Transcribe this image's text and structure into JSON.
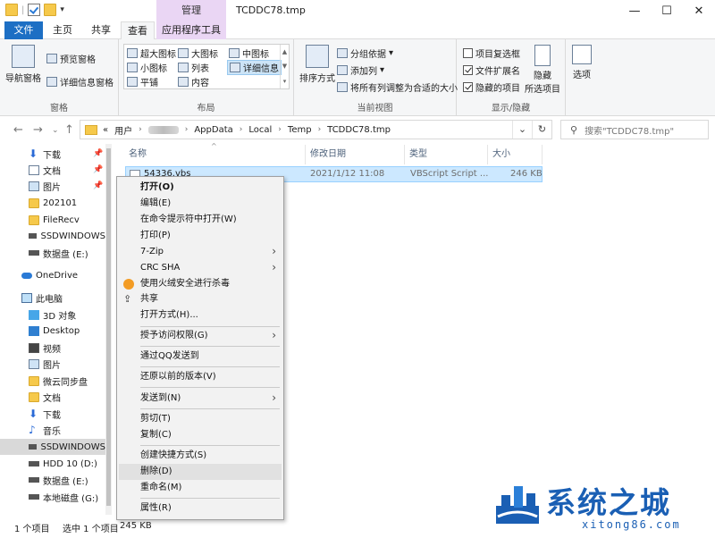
{
  "window": {
    "title": "TCDDC78.tmp",
    "context_tab_header": "管理",
    "controls": [
      "—",
      "☐",
      "✕"
    ]
  },
  "ribbon_tabs": {
    "file": "文件",
    "home": "主页",
    "share": "共享",
    "view": "查看",
    "app_tools": "应用程序工具"
  },
  "ribbon": {
    "pane": {
      "nav_pane": "导航窗格",
      "preview_pane": "预览窗格",
      "details_pane": "详细信息窗格",
      "label": "窗格"
    },
    "layout": {
      "xl_icons": "超大图标",
      "large_icons": "大图标",
      "medium_icons": "中图标",
      "small_icons": "小图标",
      "list": "列表",
      "details": "详细信息",
      "tiles": "平铺",
      "content": "内容",
      "label": "布局"
    },
    "current_view": {
      "sort_by": "排序方式",
      "group_by": "分组依据",
      "add_columns": "添加列",
      "size_all_columns": "将所有列调整为合适的大小",
      "label": "当前视图"
    },
    "show_hide": {
      "item_checkboxes": "项目复选框",
      "file_extensions": "文件扩展名",
      "hidden_items": "隐藏的项目",
      "hide_selected_1": "隐藏",
      "hide_selected_2": "所选项目",
      "label": "显示/隐藏",
      "item_checkboxes_checked": false,
      "file_extensions_checked": true,
      "hidden_items_checked": true
    },
    "options": "选项"
  },
  "address": {
    "prefix": "«",
    "crumbs": [
      "用户",
      "AppData",
      "Local",
      "Temp",
      "TCDDC78.tmp"
    ],
    "search_placeholder": "搜索\"TCDDC78.tmp\""
  },
  "sidebar": {
    "quick": [
      {
        "label": "下载",
        "pinned": true
      },
      {
        "label": "文档",
        "pinned": true
      },
      {
        "label": "图片",
        "pinned": true
      },
      {
        "label": "202101"
      },
      {
        "label": "FileRecv"
      },
      {
        "label": "SSDWINDOWS"
      },
      {
        "label": "数据盘 (E:)"
      }
    ],
    "onedrive": "OneDrive",
    "this_pc": "此电脑",
    "pc_items": [
      "3D 对象",
      "Desktop",
      "视频",
      "图片",
      "微云同步盘",
      "文档",
      "下载",
      "音乐",
      "SSDWINDOWS",
      "HDD 10 (D:)",
      "数据盘 (E:)",
      "本地磁盘 (G:)"
    ]
  },
  "file_list": {
    "columns": {
      "name": "名称",
      "date": "修改日期",
      "type": "类型",
      "size": "大小"
    },
    "rows": [
      {
        "name": "54336.vbs",
        "date": "2021/1/12 11:08",
        "type": "VBScript Script ...",
        "size": "246 KB"
      }
    ]
  },
  "context_menu": {
    "open": "打开(O)",
    "edit": "编辑(E)",
    "open_cmd": "在命令提示符中打开(W)",
    "print": "打印(P)",
    "zip": "7-Zip",
    "crc": "CRC SHA",
    "antivirus": "使用火绒安全进行杀毒",
    "share": "共享",
    "open_with": "打开方式(H)...",
    "grant_access": "授予访问权限(G)",
    "qq_send": "通过QQ发送到",
    "restore": "还原以前的版本(V)",
    "send_to": "发送到(N)",
    "cut": "剪切(T)",
    "copy": "复制(C)",
    "create_shortcut": "创建快捷方式(S)",
    "delete": "删除(D)",
    "rename": "重命名(M)",
    "properties": "属性(R)"
  },
  "status": {
    "count": "1 个项目",
    "selected": "选中 1 个项目",
    "size": "245 KB"
  },
  "watermark": {
    "name": "系统之城",
    "url": "xitong86.com"
  },
  "colors": {
    "accent": "#1d6fc4",
    "context_tab": "#ead6f4",
    "selection": "#cce8ff"
  }
}
